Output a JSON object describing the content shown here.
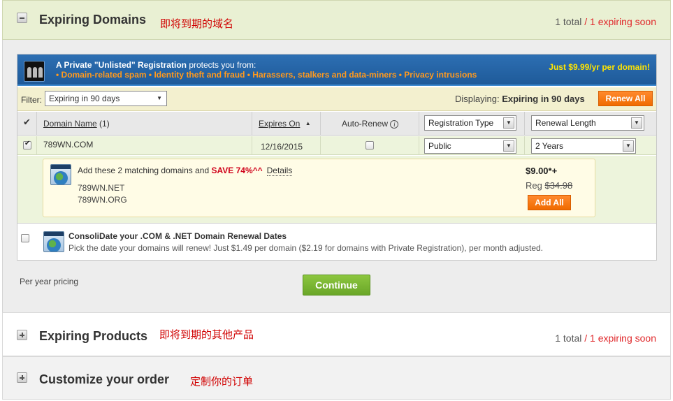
{
  "expiring_domains": {
    "title": "Expiring Domains",
    "annotation": "即将到期的域名",
    "total": "1 total",
    "separator": " / ",
    "soon": "1 expiring soon"
  },
  "privacy": {
    "line1_bold": "A Private \"Unlisted\" Registration",
    "line1_rest": " protects you from:",
    "bullets": "• Domain-related spam  • Identity theft and fraud  • Harassers, stalkers and data-miners  • Privacy intrusions",
    "price": "Just $9.99/yr per domain!"
  },
  "filter": {
    "label": "Filter:",
    "value": "Expiring in 90 days",
    "displaying_label": "Displaying:",
    "displaying_value": "Expiring in 90 days",
    "renew_all": "Renew All"
  },
  "table": {
    "header": {
      "check": "✔",
      "domain_name": "Domain Name",
      "domain_count": "(1)",
      "expires_on": "Expires On",
      "sort_arrow": "▲",
      "auto_renew": "Auto-Renew",
      "info_icon": "i",
      "registration_type": "Registration Type",
      "renewal_length": "Renewal Length"
    },
    "row": {
      "domain": "789WN.COM",
      "expires": "12/16/2015",
      "registration_type": "Public",
      "renewal_length": "2 Years"
    }
  },
  "suggestion": {
    "text": "Add these 2 matching domains and ",
    "save": "SAVE 74%^^",
    "details": "Details",
    "domains": [
      "789WN.NET",
      "789WN.ORG"
    ],
    "price": "$9.00*+",
    "reg_label": "Reg ",
    "reg_price": "$34.98",
    "add_all": "Add All"
  },
  "consolidate": {
    "title": "ConsoliDate your .COM & .NET Domain Renewal Dates",
    "desc": "Pick the date your domains will renew! Just $1.49 per domain ($2.19 for domains with Private Registration), per month adjusted."
  },
  "footer": {
    "per_year": "Per year pricing",
    "continue": "Continue"
  },
  "expiring_products": {
    "title": "Expiring Products",
    "annotation": "即将到期的其他产品",
    "total": "1 total",
    "separator": " / ",
    "soon": "1 expiring soon"
  },
  "customize": {
    "title": "Customize your order",
    "annotation": "定制你的订单"
  },
  "colors": {
    "accent_orange": "#f06b00",
    "continue_green": "#6aa628",
    "header_green": "#e9f0d3",
    "alert_red": "#e0282b"
  }
}
